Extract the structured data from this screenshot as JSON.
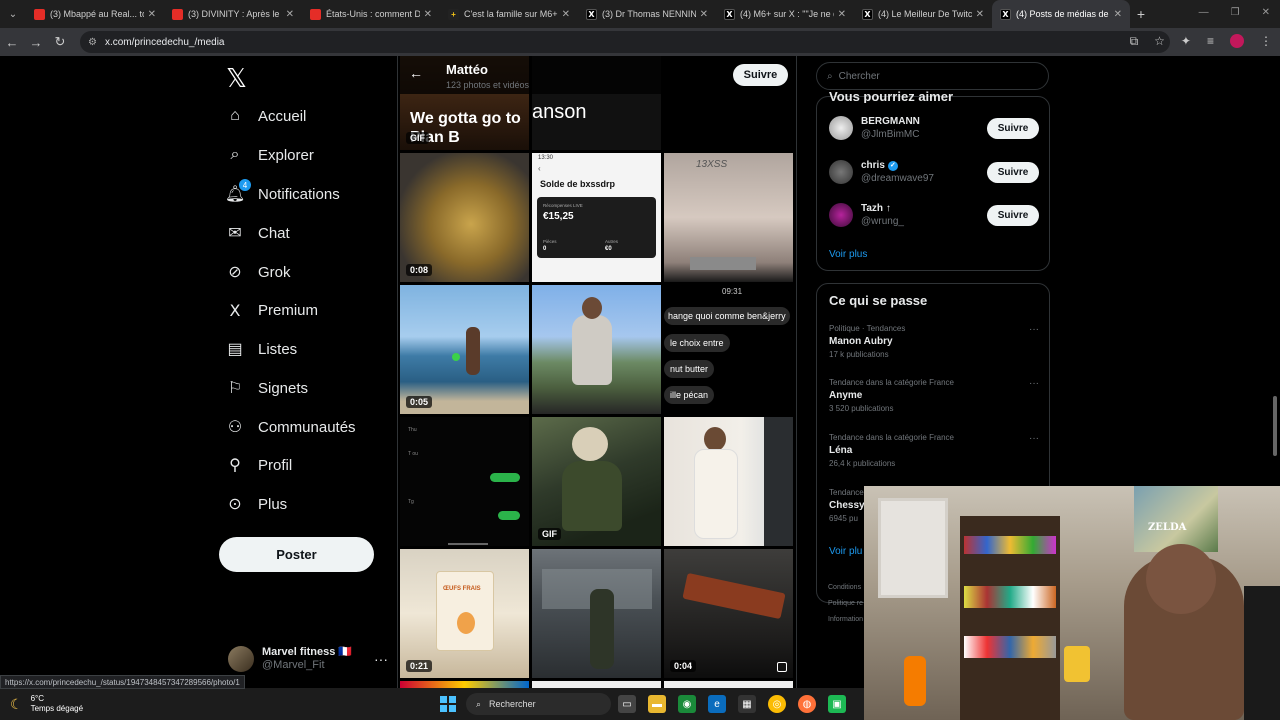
{
  "browser": {
    "tabs": [
      {
        "label": "(3) Mbappé au Real... tou",
        "icon": "youtube-icon",
        "active": false
      },
      {
        "label": "(3) DIVINITY : Après le tr",
        "icon": "youtube-icon",
        "active": false
      },
      {
        "label": "États-Unis : comment Do",
        "icon": "youtube-icon",
        "active": false
      },
      {
        "label": "C'est la famille sur M6+ :",
        "icon": "m6-icon",
        "active": false
      },
      {
        "label": "(3) Dr Thomas NENNING",
        "icon": "x-icon",
        "active": false
      },
      {
        "label": "(4) M6+ sur X : \"\"Je ne qu",
        "icon": "x-icon",
        "active": false
      },
      {
        "label": "(4) Le Meilleur De Twitch",
        "icon": "x-icon",
        "active": false
      },
      {
        "label": "(4) Posts de médias de M",
        "icon": "x-icon",
        "active": true
      }
    ],
    "url": "x.com/princedechu_/media",
    "status_url": "https://x.com/princedechu_/status/1947348457347289566/photo/1"
  },
  "nav": {
    "items": [
      {
        "label": "Accueil",
        "icon": "home-icon"
      },
      {
        "label": "Explorer",
        "icon": "search-icon"
      },
      {
        "label": "Notifications",
        "icon": "bell-icon",
        "badge": "4"
      },
      {
        "label": "Chat",
        "icon": "mail-icon"
      },
      {
        "label": "Grok",
        "icon": "grok-icon"
      },
      {
        "label": "Premium",
        "icon": "x-icon"
      },
      {
        "label": "Listes",
        "icon": "list-icon"
      },
      {
        "label": "Signets",
        "icon": "bookmark-icon"
      },
      {
        "label": "Communautés",
        "icon": "people-icon"
      },
      {
        "label": "Profil",
        "icon": "person-icon"
      },
      {
        "label": "Plus",
        "icon": "more-circle-icon"
      }
    ],
    "post_label": "Poster",
    "account": {
      "name": "Marvel fitness 🇫🇷",
      "handle": "@Marvel_Fit"
    }
  },
  "profile": {
    "name": "Mattéo",
    "count": "123 photos et vidéos",
    "follow_label": "Suivre"
  },
  "media": {
    "tiles": [
      {
        "text": "We gotta go to Plan B",
        "badge": "GIF"
      },
      {
        "text": "anson"
      },
      {
        "text": ""
      },
      {
        "badge": "0:08"
      },
      {
        "text": "Solde de bxssdrp",
        "amount": "€15,25",
        "time": "13:30",
        "rewards": "Récompenses LIVE",
        "p_label": "Pièces",
        "p_value": "0",
        "r_label": "Autres",
        "r_value": "€0"
      },
      {
        "text": "13XSS"
      },
      {
        "badge": "0:05"
      },
      {
        "text": ""
      },
      {
        "time": "09:31",
        "bubbles": [
          "hange quoi comme ben&jerry",
          "le choix entre",
          "nut butter",
          "ille pécan"
        ]
      },
      {
        "chat": [
          "Thu",
          "T ou",
          "Tg"
        ]
      },
      {
        "badge": "GIF"
      },
      {
        "text": ""
      },
      {
        "badge": "0:21",
        "text": "ŒUFS FRAIS"
      },
      {
        "text": ""
      },
      {
        "badge": "0:04"
      }
    ]
  },
  "right": {
    "search_placeholder": "Chercher",
    "who_title": "Vous pourriez aimer",
    "who": [
      {
        "name": "BERGMANN",
        "handle": "@JlmBimMC",
        "verified": false,
        "follow": "Suivre"
      },
      {
        "name": "chris",
        "handle": "@dreamwave97",
        "verified": true,
        "follow": "Suivre"
      },
      {
        "name": "Tazh ↑",
        "handle": "@wrung_",
        "verified": false,
        "follow": "Suivre"
      }
    ],
    "see_more": "Voir plus",
    "trends_title": "Ce qui se passe",
    "trends": [
      {
        "category": "Politique · Tendances",
        "name": "Manon Aubry",
        "count": "17 k publications"
      },
      {
        "category": "Tendance dans la catégorie France",
        "name": "Anyme",
        "count": "3 520 publications"
      },
      {
        "category": "Tendance dans la catégorie France",
        "name": "Léna",
        "count": "26,4 k publications"
      },
      {
        "category": "Tendance",
        "name": "Chessy",
        "count": "6945 pu"
      }
    ],
    "see_more_2": "Voir plu",
    "footer": [
      "Conditions",
      "Politique re",
      "Information"
    ]
  },
  "taskbar": {
    "temp": "6°C",
    "weather": "Temps dégagé",
    "search": "Rechercher"
  },
  "webcam": {
    "poster_text": "ZELDA"
  }
}
